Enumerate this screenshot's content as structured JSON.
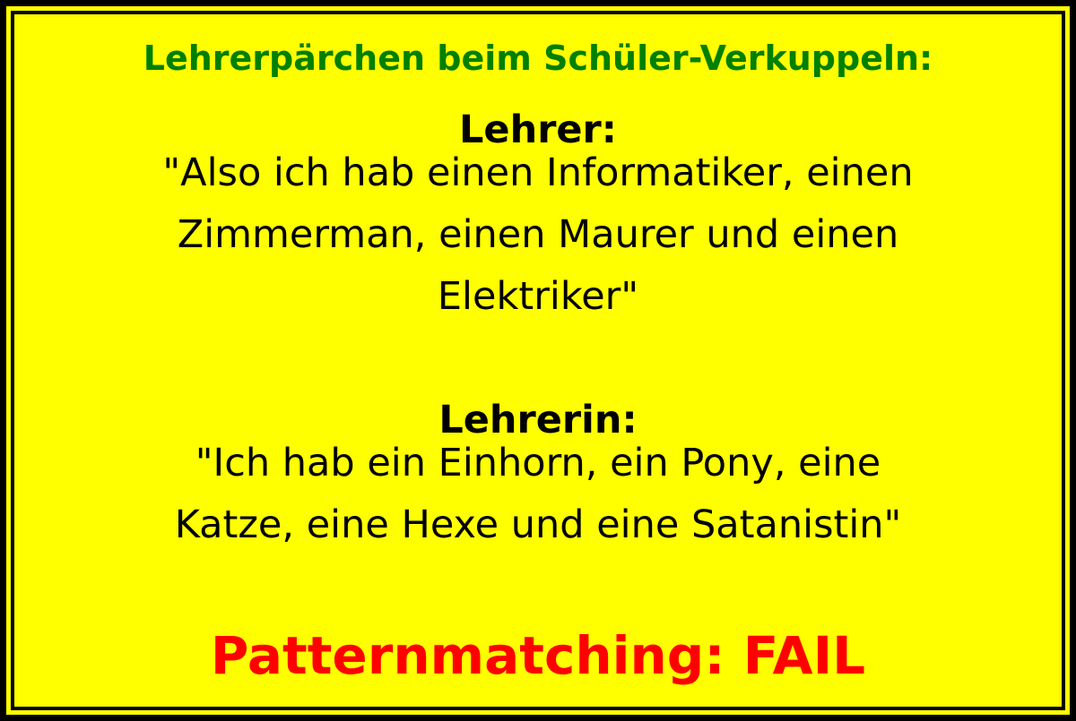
{
  "colors": {
    "background": "#ffff00",
    "border": "#000000",
    "title": "#008000",
    "text": "#000000",
    "punchline": "#ff0000"
  },
  "title": "Lehrerpärchen beim Schüler-Verkuppeln:",
  "dialogue": [
    {
      "speaker": "Lehrer:",
      "quote_lines": [
        "\"Also ich hab einen Informatiker, einen",
        "Zimmerman, einen Maurer und einen",
        "Elektriker\""
      ]
    },
    {
      "speaker": "Lehrerin:",
      "quote_lines": [
        "\"Ich hab ein Einhorn, ein Pony, eine",
        "Katze, eine Hexe und eine Satanistin\""
      ]
    }
  ],
  "punchline": "Patternmatching: FAIL"
}
